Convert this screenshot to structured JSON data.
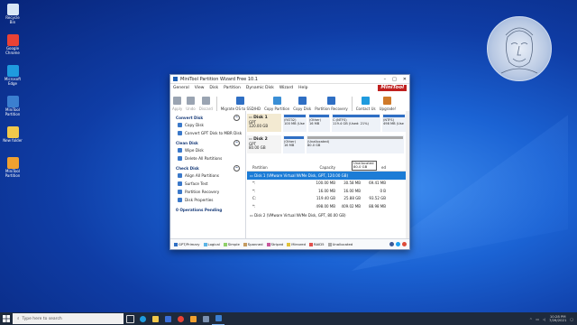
{
  "desktop": {
    "icons": [
      {
        "label": "Recycle Bin",
        "color": "#d8e6f5"
      },
      {
        "label": "Google Chrome",
        "color": "#e94235"
      },
      {
        "label": "Microsoft Edge",
        "color": "#1f9bde"
      },
      {
        "label": "MiniTool Partition",
        "color": "#3b7fd0"
      },
      {
        "label": "New folder",
        "color": "#f1c84b"
      },
      {
        "label": "MiniTool Partition",
        "color": "#f0a030"
      }
    ]
  },
  "app": {
    "title": "MiniTool Partition Wizard Free 10.1",
    "menu": [
      "General",
      "View",
      "Disk",
      "Partition",
      "Dynamic Disk",
      "Wizard",
      "Help"
    ],
    "brand": "MiniTool",
    "toolbar": [
      {
        "label": "Apply",
        "icon": "check-icon",
        "disabled": true
      },
      {
        "label": "Undo",
        "icon": "undo-icon",
        "disabled": true
      },
      {
        "label": "Discard",
        "icon": "close-icon",
        "disabled": true
      },
      {
        "label": "Migrate OS to SSD/HD",
        "icon": "migrate-icon"
      },
      {
        "label": "Copy Partition",
        "icon": "copy-partition-icon"
      },
      {
        "label": "Copy Disk",
        "icon": "copy-disk-icon"
      },
      {
        "label": "Partition Recovery",
        "icon": "recovery-icon"
      },
      {
        "label": "Contact Us",
        "icon": "contact-icon"
      },
      {
        "label": "Upgrade!",
        "icon": "upgrade-icon"
      }
    ],
    "sidebar": [
      {
        "header": "Convert Disk",
        "items": [
          "Copy Disk",
          "Convert GPT Disk to MBR Disk"
        ]
      },
      {
        "header": "Clean Disk",
        "items": [
          "Wipe Disk",
          "Delete All Partitions"
        ]
      },
      {
        "header": "Check Disk",
        "items": [
          "Align All Partitions",
          "Surface Test",
          "Partition Recovery",
          "Disk Properties"
        ]
      },
      {
        "header": "0 Operations Pending",
        "items": []
      }
    ],
    "disk1": {
      "name": "Disk 1",
      "type": "GPT",
      "size": "120.00 GB",
      "parts": [
        {
          "name": "(FAT32)",
          "info": "100 MB (Use",
          "color": "#2f6fc4"
        },
        {
          "name": "(Other)",
          "info": "16 MB",
          "color": "#2f6fc4"
        },
        {
          "name": "C:(NTFS)",
          "info": "119.4 GB (Used: 21%)",
          "color": "#2f6fc4"
        },
        {
          "name": "(NTFS)",
          "info": "498 MB (Use",
          "color": "#2f6fc4"
        }
      ]
    },
    "disk2": {
      "name": "Disk 2",
      "type": "GPT",
      "size": "80.00 GB",
      "parts": [
        {
          "name": "(Other)",
          "info": "16 MB",
          "color": "#2f6fc4"
        },
        {
          "name": "(Unallocated)",
          "info": "80.0 GB",
          "color": "#a9a9a9"
        }
      ]
    },
    "tooltip": {
      "line1": "Unallocated",
      "line2": "80.0 GB"
    },
    "table": {
      "headers": [
        "Partition",
        "Capacity",
        "Used",
        "Unused"
      ],
      "header_partial": "U",
      "header_partial2": "ed",
      "rows": [
        {
          "partition": "Disk 1 (VMware Virtual NVMe Disk, GPT, 120.00 GB)",
          "capacity": "",
          "used": "",
          "unused": "",
          "selected": true
        },
        {
          "partition": "*:",
          "capacity": "100.00 MB",
          "used": "30.58 MB",
          "unused": "69.41 MB"
        },
        {
          "partition": "*:",
          "capacity": "16.00 MB",
          "used": "16.00 MB",
          "unused": "0 B"
        },
        {
          "partition": "C:",
          "capacity": "119.40 GB",
          "used": "25.88 GB",
          "unused": "93.52 GB"
        },
        {
          "partition": "*:",
          "capacity": "498.00 MB",
          "used": "409.02 MB",
          "unused": "88.98 MB"
        },
        {
          "partition": "Disk 2 (VMware Virtual NVMe Disk, GPT, 80.00 GB)",
          "capacity": "",
          "used": "",
          "unused": ""
        }
      ]
    },
    "legend": [
      {
        "label": "GPT/Primary",
        "color": "#2f6fc4"
      },
      {
        "label": "Logical",
        "color": "#5bb4e6"
      },
      {
        "label": "Simple",
        "color": "#8fd16a"
      },
      {
        "label": "Spanned",
        "color": "#c59b62"
      },
      {
        "label": "Striped",
        "color": "#c7569c"
      },
      {
        "label": "Mirrored",
        "color": "#e0c23a"
      },
      {
        "label": "RAID5",
        "color": "#e0504d"
      },
      {
        "label": "Unallocated",
        "color": "#a9a9a9"
      }
    ]
  },
  "taskbar": {
    "search_placeholder": "Type here to search",
    "time": "10:28 PM",
    "date": "7/26/2021"
  }
}
